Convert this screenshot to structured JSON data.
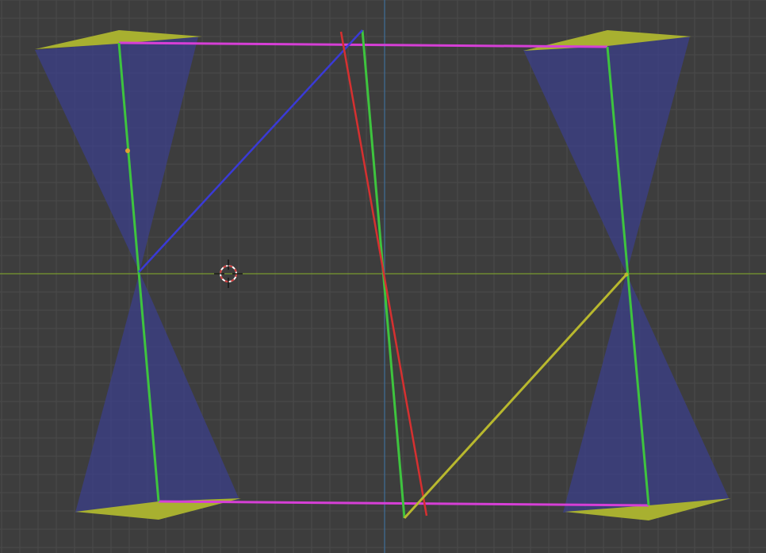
{
  "viewport": {
    "background": "#3d3d3d",
    "grid_color": "#4a4a4a",
    "x_axis_color": "#7a9a30",
    "y_axis_color": "#3f6f9a"
  },
  "colors": {
    "cone_fill": "#3a3f8f",
    "plate_fill": "#a8b030",
    "magenta_edge": "#d63fd6",
    "green_edge": "#3ec43e",
    "blue_edge": "#3a3ad6",
    "red_edge": "#d63030",
    "yellow_edge": "#b8b82e",
    "cursor_red": "#d23a3a",
    "cursor_white": "#ffffff",
    "vertex_orange": "#e0a030"
  },
  "icons": {
    "cursor": "3d-cursor-icon"
  }
}
